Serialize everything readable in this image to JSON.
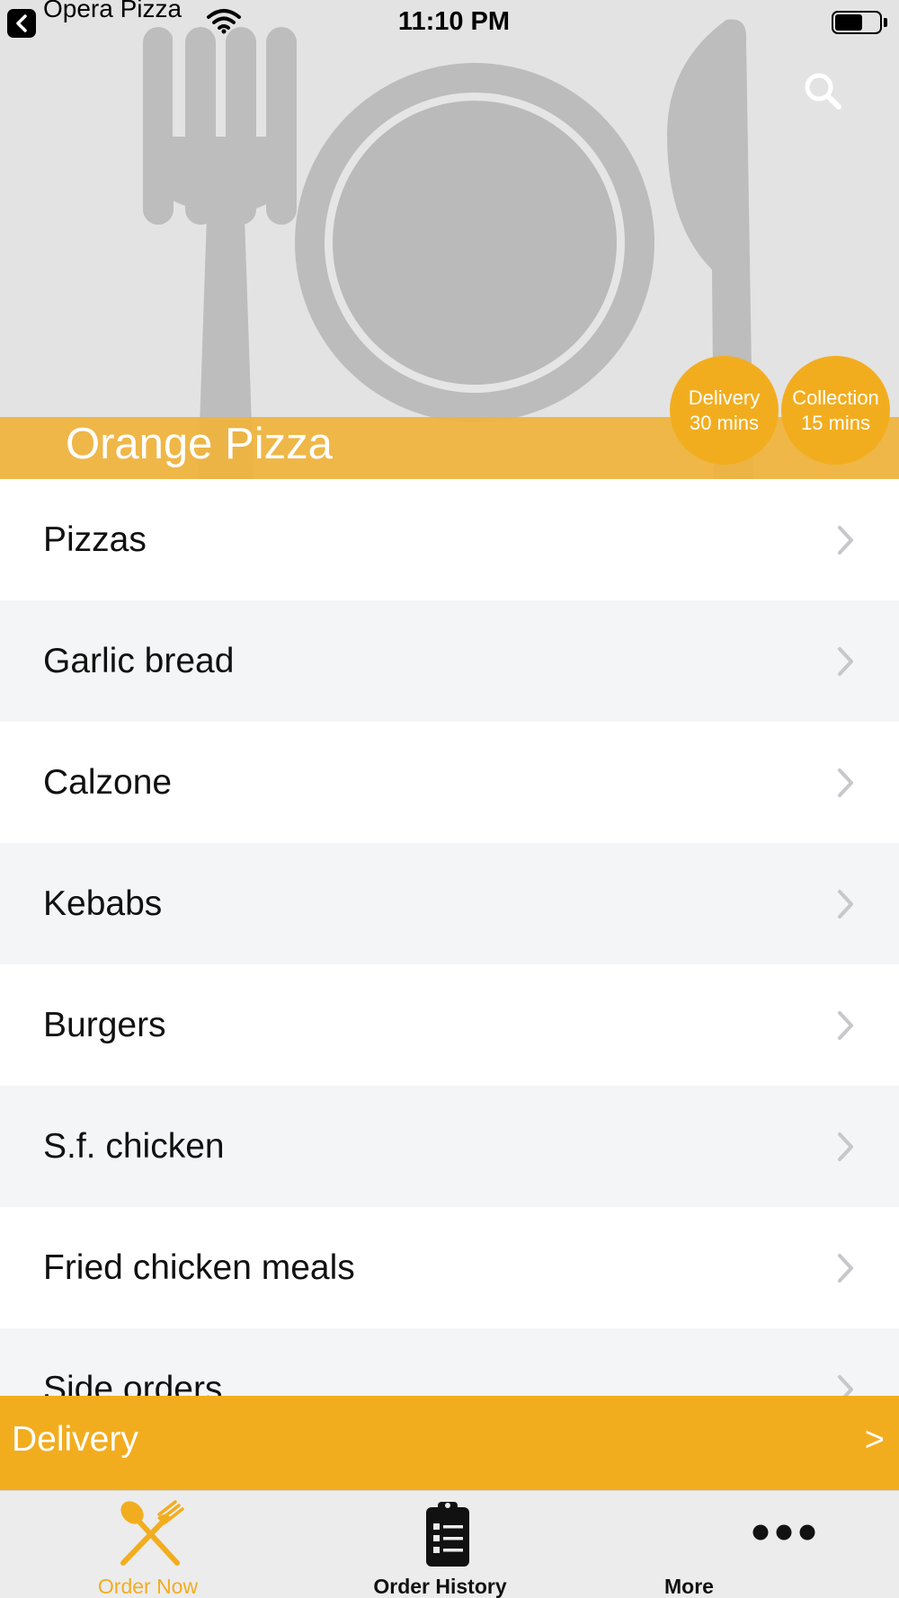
{
  "status_bar": {
    "app_name": "Opera Pizza",
    "time": "11:10 PM",
    "battery_level": 0.62
  },
  "restaurant": {
    "name": "Orange Pizza"
  },
  "badges": {
    "delivery": {
      "label": "Delivery",
      "time": "30 mins"
    },
    "collection": {
      "label": "Collection",
      "time": "15 mins"
    }
  },
  "menu": {
    "categories": [
      "Pizzas",
      "Garlic bread",
      "Calzone",
      "Kebabs",
      "Burgers",
      "S.f. chicken",
      "Fried chicken meals",
      "Side orders"
    ]
  },
  "delivery_bar": {
    "label": "Delivery",
    "arrow": ">"
  },
  "tabs": [
    {
      "label": "Order Now",
      "icon": "fork-spoon-icon",
      "active": true
    },
    {
      "label": "Order History",
      "icon": "clipboard-list-icon",
      "active": false
    },
    {
      "label": "More",
      "icon": "more-dots-icon",
      "active": false
    }
  ],
  "colors": {
    "accent": "#f2ad1f",
    "name_bar": "#f0b33b",
    "hero_background": "#e3e3e3",
    "row_alt": "#f4f5f7"
  }
}
